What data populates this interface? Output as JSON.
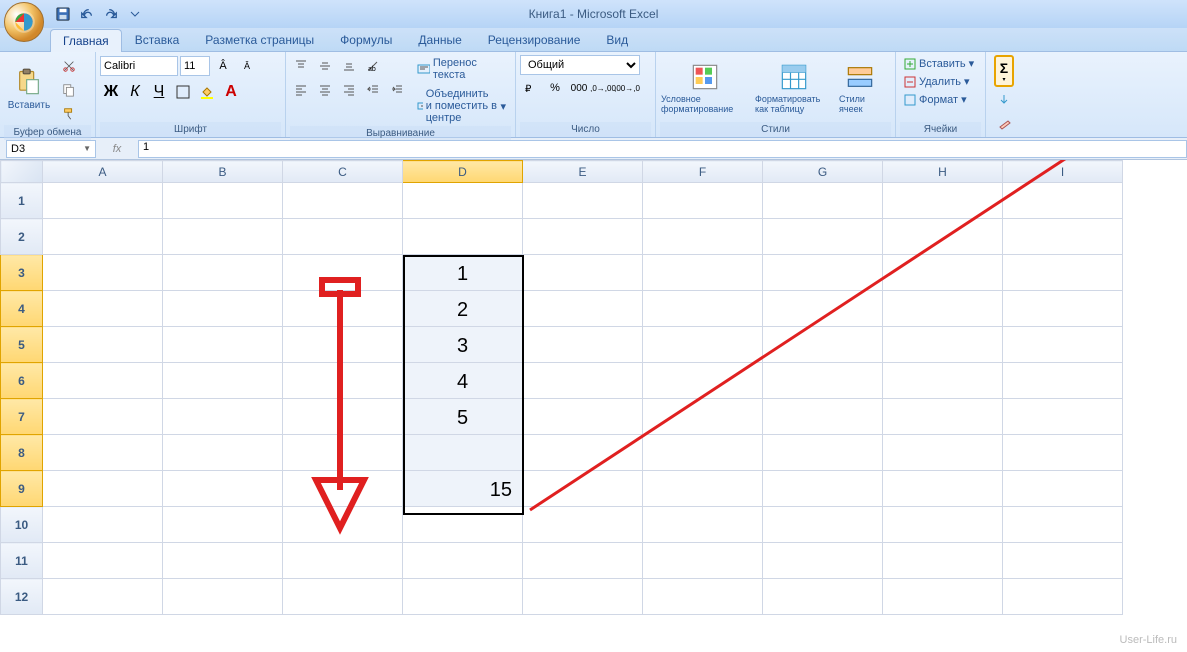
{
  "title": "Книга1 - Microsoft Excel",
  "qat": {
    "save": "save-icon",
    "undo": "undo-icon",
    "redo": "redo-icon"
  },
  "tabs": [
    "Главная",
    "Вставка",
    "Разметка страницы",
    "Формулы",
    "Данные",
    "Рецензирование",
    "Вид"
  ],
  "active_tab": 0,
  "clipboard": {
    "paste": "Вставить",
    "label": "Буфер обмена"
  },
  "font": {
    "name": "Calibri",
    "size": "11",
    "bold": "Ж",
    "italic": "К",
    "underline": "Ч",
    "label": "Шрифт"
  },
  "alignment": {
    "wrap": "Перенос текста",
    "merge": "Объединить и поместить в центре",
    "label": "Выравнивание"
  },
  "number": {
    "format": "Общий",
    "label": "Число"
  },
  "styles": {
    "conditional": "Условное форматирование",
    "format_table": "Форматировать как таблицу",
    "cell_styles": "Стили ячеек",
    "label": "Стили"
  },
  "cells": {
    "insert": "Вставить",
    "delete": "Удалить",
    "format": "Формат",
    "label": "Ячейки"
  },
  "editing": {
    "sigma": "Σ"
  },
  "name_box": "D3",
  "fx_label": "fx",
  "formula_value": "1",
  "columns": [
    "A",
    "B",
    "C",
    "D",
    "E",
    "F",
    "G",
    "H",
    "I"
  ],
  "active_col_index": 3,
  "rows": [
    1,
    2,
    3,
    4,
    5,
    6,
    7,
    8,
    9,
    10,
    11,
    12
  ],
  "active_row_start": 3,
  "active_row_end": 9,
  "cells_data": {
    "D3": "1",
    "D4": "2",
    "D5": "3",
    "D6": "4",
    "D7": "5",
    "D9": "15"
  },
  "watermark": "User-Life.ru"
}
